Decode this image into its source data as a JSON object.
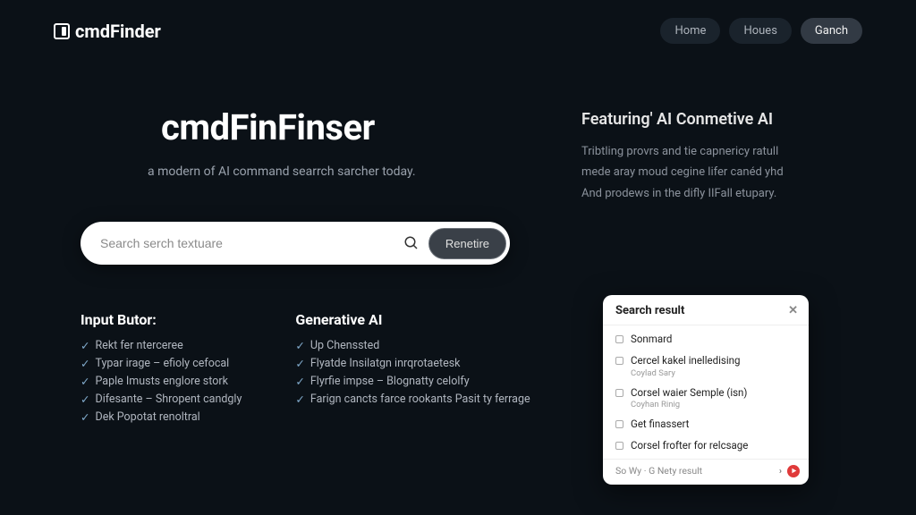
{
  "brand": "cmdFinder",
  "nav": [
    {
      "label": "Home",
      "active": false
    },
    {
      "label": "Houes",
      "active": false
    },
    {
      "label": "Ganch",
      "active": true
    }
  ],
  "hero": {
    "title": "cmdFinFinser",
    "subtitle": "a modern of AI command searrch sarcher today."
  },
  "feature_panel": {
    "title": "Featuring' AI Conmetive AI",
    "desc_line1": "Tribtling provrs and tie capnericy ratull",
    "desc_line2": "mede aray moud cegine lifer canéd yhd",
    "desc_line3": "And prodews in the difly IIFall etupary."
  },
  "search": {
    "placeholder": "Search serch textuare",
    "button": "Renetire"
  },
  "columns": [
    {
      "title": "Input Butor:",
      "items": [
        "Rekt fer nterceree",
        "Typar irage – efioly cefocal",
        "Paple Imusts englore stork",
        "Difesante – Shropent candgly",
        "Dek Popotat renoltral"
      ]
    },
    {
      "title": "Generative AI",
      "items": [
        "Up Chenssted",
        "Flyatde Insilatgn inrqrotaetesk",
        "Flyrfie impse – Blognatty celolfy",
        "Farign cancts farce rookants Pasit ty ferrage"
      ]
    }
  ],
  "results": {
    "title": "Search result",
    "items": [
      {
        "label": "Sonmard",
        "sub": ""
      },
      {
        "label": "Cercel kakel inelledising",
        "sub": "Coylad Sary"
      },
      {
        "label": "Corsel waier Semple (isn)",
        "sub": "Coyhan Rinig"
      },
      {
        "label": "Get finassert",
        "sub": ""
      },
      {
        "label": "Corsel frofter for relcsage",
        "sub": ""
      }
    ],
    "footer": "So Wy · G Nety result"
  }
}
